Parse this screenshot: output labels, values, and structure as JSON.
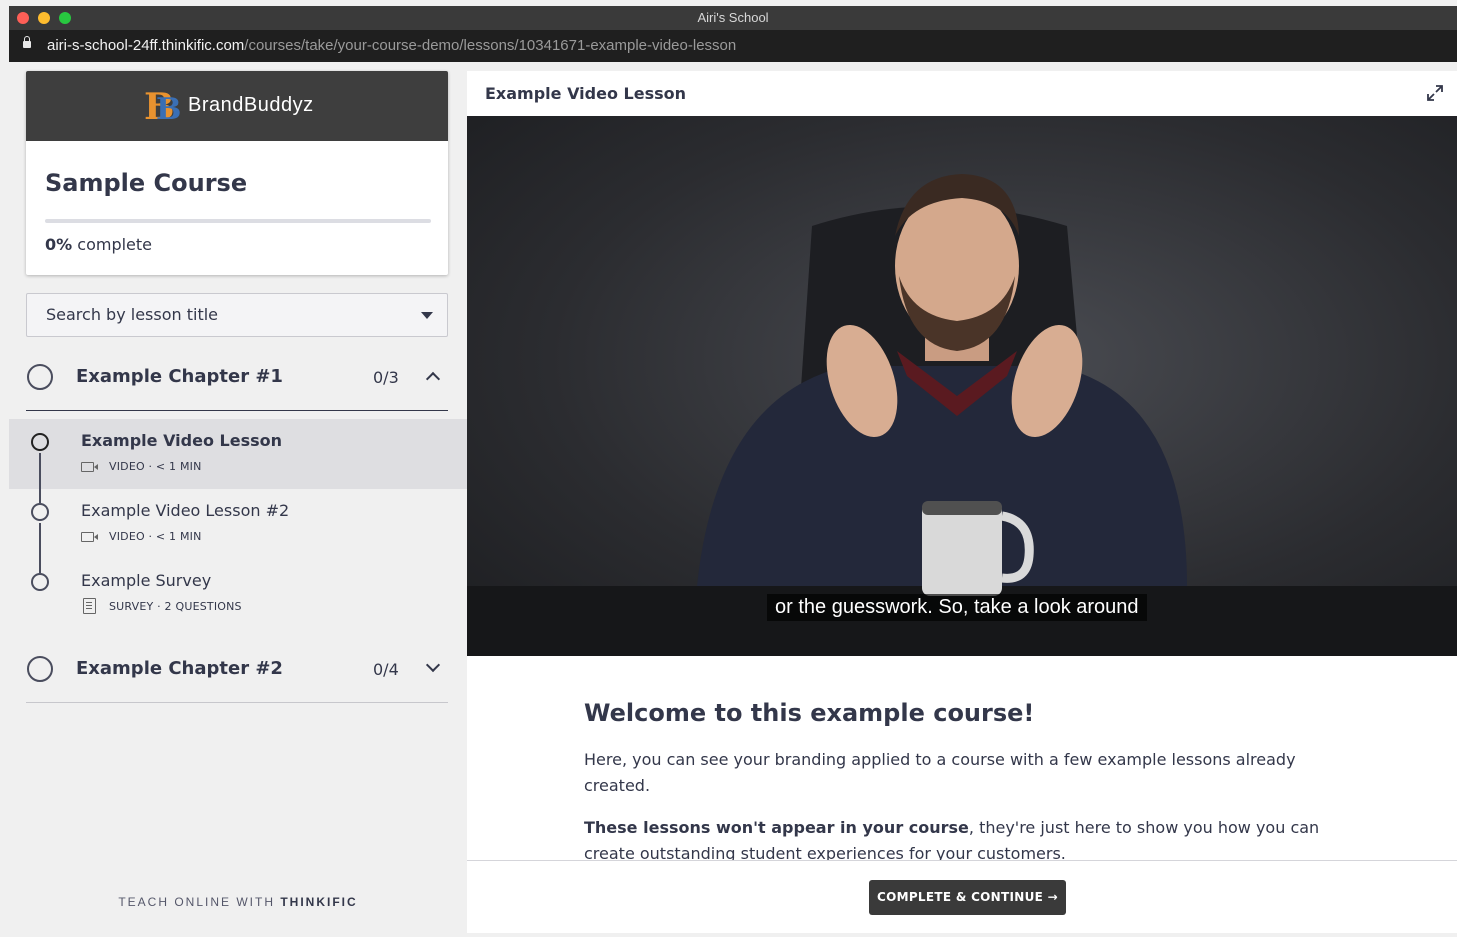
{
  "window": {
    "title": "Airi's School",
    "url_host": "airi-s-school-24ff.thinkific.com",
    "url_path": "/courses/take/your-course-demo/lessons/10341671-example-video-lesson"
  },
  "sidebar": {
    "brand_name": "BrandBuddyz",
    "course_title": "Sample Course",
    "progress": {
      "percent_label": "0%",
      "suffix": "complete",
      "fraction": 0
    },
    "search_placeholder": "Search by lesson title",
    "chapters": [
      {
        "title": "Example Chapter #1",
        "count": "0/3",
        "expanded": true,
        "lessons": [
          {
            "title": "Example Video Lesson",
            "meta": "VIDEO · < 1 MIN",
            "icon": "video-icon",
            "active": true
          },
          {
            "title": "Example Video Lesson #2",
            "meta": "VIDEO · < 1 MIN",
            "icon": "video-icon",
            "active": false
          },
          {
            "title": "Example Survey",
            "meta": "SURVEY · 2 QUESTIONS",
            "icon": "survey-icon",
            "active": false
          }
        ]
      },
      {
        "title": "Example Chapter #2",
        "count": "0/4",
        "expanded": false
      }
    ],
    "footer_prefix": "TEACH ONLINE WITH",
    "footer_brand": "THINKIFIC"
  },
  "main": {
    "lesson_title": "Example Video Lesson",
    "video_caption": "or the guesswork. So, take a look around",
    "heading": "Welcome to this example course!",
    "para1": "Here, you can see your branding applied to a course with a few example lessons already created.",
    "para2_bold": "These lessons won't appear in your course",
    "para2_rest": ", they're just here to show you how you can create outstanding student experiences for your customers.",
    "cta_label": "COMPLETE & CONTINUE →"
  },
  "colors": {
    "brand_bar": "#3e3e3e",
    "text_primary": "#33374a",
    "active_lesson_bg": "#dedee1",
    "cta_bg": "#3a3a3a",
    "logo_orange": "#e8922f",
    "logo_blue": "#3a6fb5"
  }
}
